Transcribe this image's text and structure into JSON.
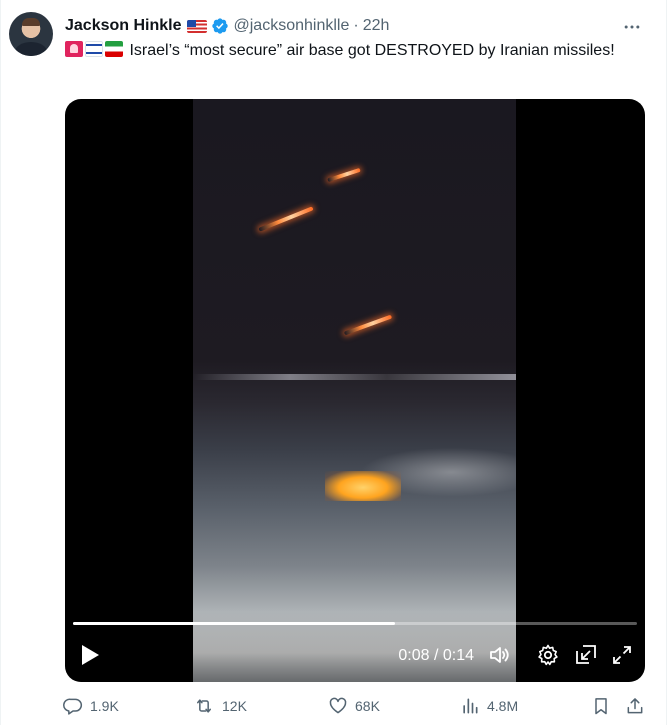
{
  "author": {
    "name": "Jackson Hinkle",
    "handle": "@jacksonhinklle",
    "separator": "·",
    "time": "22h"
  },
  "tweet": {
    "flags": [
      "siren-icon",
      "israel-flag",
      "iran-flag"
    ],
    "text": "Israel’s “most secure” air base got DESTROYED by Iranian missiles!"
  },
  "video": {
    "time_readout": "0:08 / 0:14",
    "progress": 0.5714
  },
  "actions": {
    "replies": "1.9K",
    "reposts": "12K",
    "likes": "68K",
    "views": "4.8M"
  },
  "colors": {
    "text": "#0f1419",
    "secondary": "#536471",
    "verified": "#1d9bf0"
  }
}
